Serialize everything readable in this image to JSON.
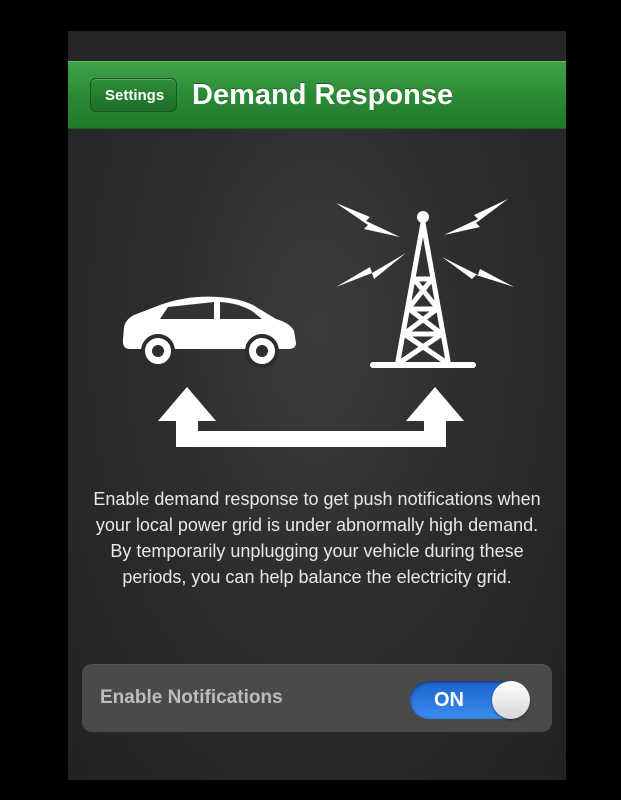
{
  "navbar": {
    "back_label": "Settings",
    "title": "Demand Response"
  },
  "illustration": {
    "icons": [
      "car-icon",
      "radio-tower-icon",
      "lightning-bolt-icon",
      "two-way-arrow-icon"
    ]
  },
  "description": "Enable demand response to get push notifications when your local power grid is under abnormally high demand. By temporarily unplugging your vehicle during these periods, you can help balance the electricity grid.",
  "settings": {
    "enable_notifications": {
      "label": "Enable Notifications",
      "value": "ON",
      "enabled": true
    }
  },
  "colors": {
    "navbar_green": "#2b8b35",
    "toggle_blue": "#1d62c8",
    "background": "#2d2d2d"
  }
}
